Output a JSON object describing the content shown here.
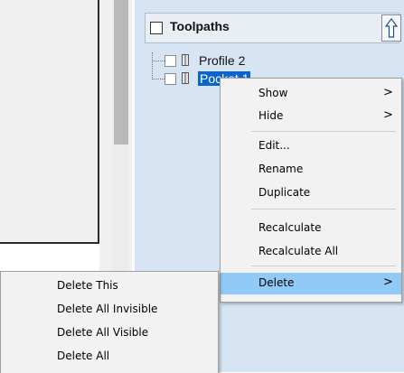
{
  "toolpaths_panel": {
    "title": "Toolpaths",
    "items": [
      {
        "label": "Profile 2",
        "selected": false
      },
      {
        "label": "Pocket 1",
        "selected": true
      }
    ]
  },
  "context_menu": {
    "items": [
      {
        "label": "Show",
        "submenu": true
      },
      {
        "label": "Hide",
        "submenu": true
      },
      {
        "label": "Edit..."
      },
      {
        "label": "Rename"
      },
      {
        "label": "Duplicate"
      },
      {
        "label": "Recalculate"
      },
      {
        "label": "Recalculate All"
      },
      {
        "label": "Delete",
        "submenu": true,
        "highlighted": true
      }
    ],
    "arrow_glyph": ">"
  },
  "delete_submenu": {
    "items": [
      {
        "label": "Delete This"
      },
      {
        "label": "Delete All Invisible"
      },
      {
        "label": "Delete All Visible"
      },
      {
        "label": "Delete All"
      }
    ]
  },
  "colors": {
    "panel_bg": "#d6e4f3",
    "selection": "#0a64d2",
    "menu_highlight": "#91c9f7"
  },
  "icons": [
    "checkbox-icon",
    "up-arrow-icon",
    "tool-icon",
    "chevron-right-icon"
  ]
}
